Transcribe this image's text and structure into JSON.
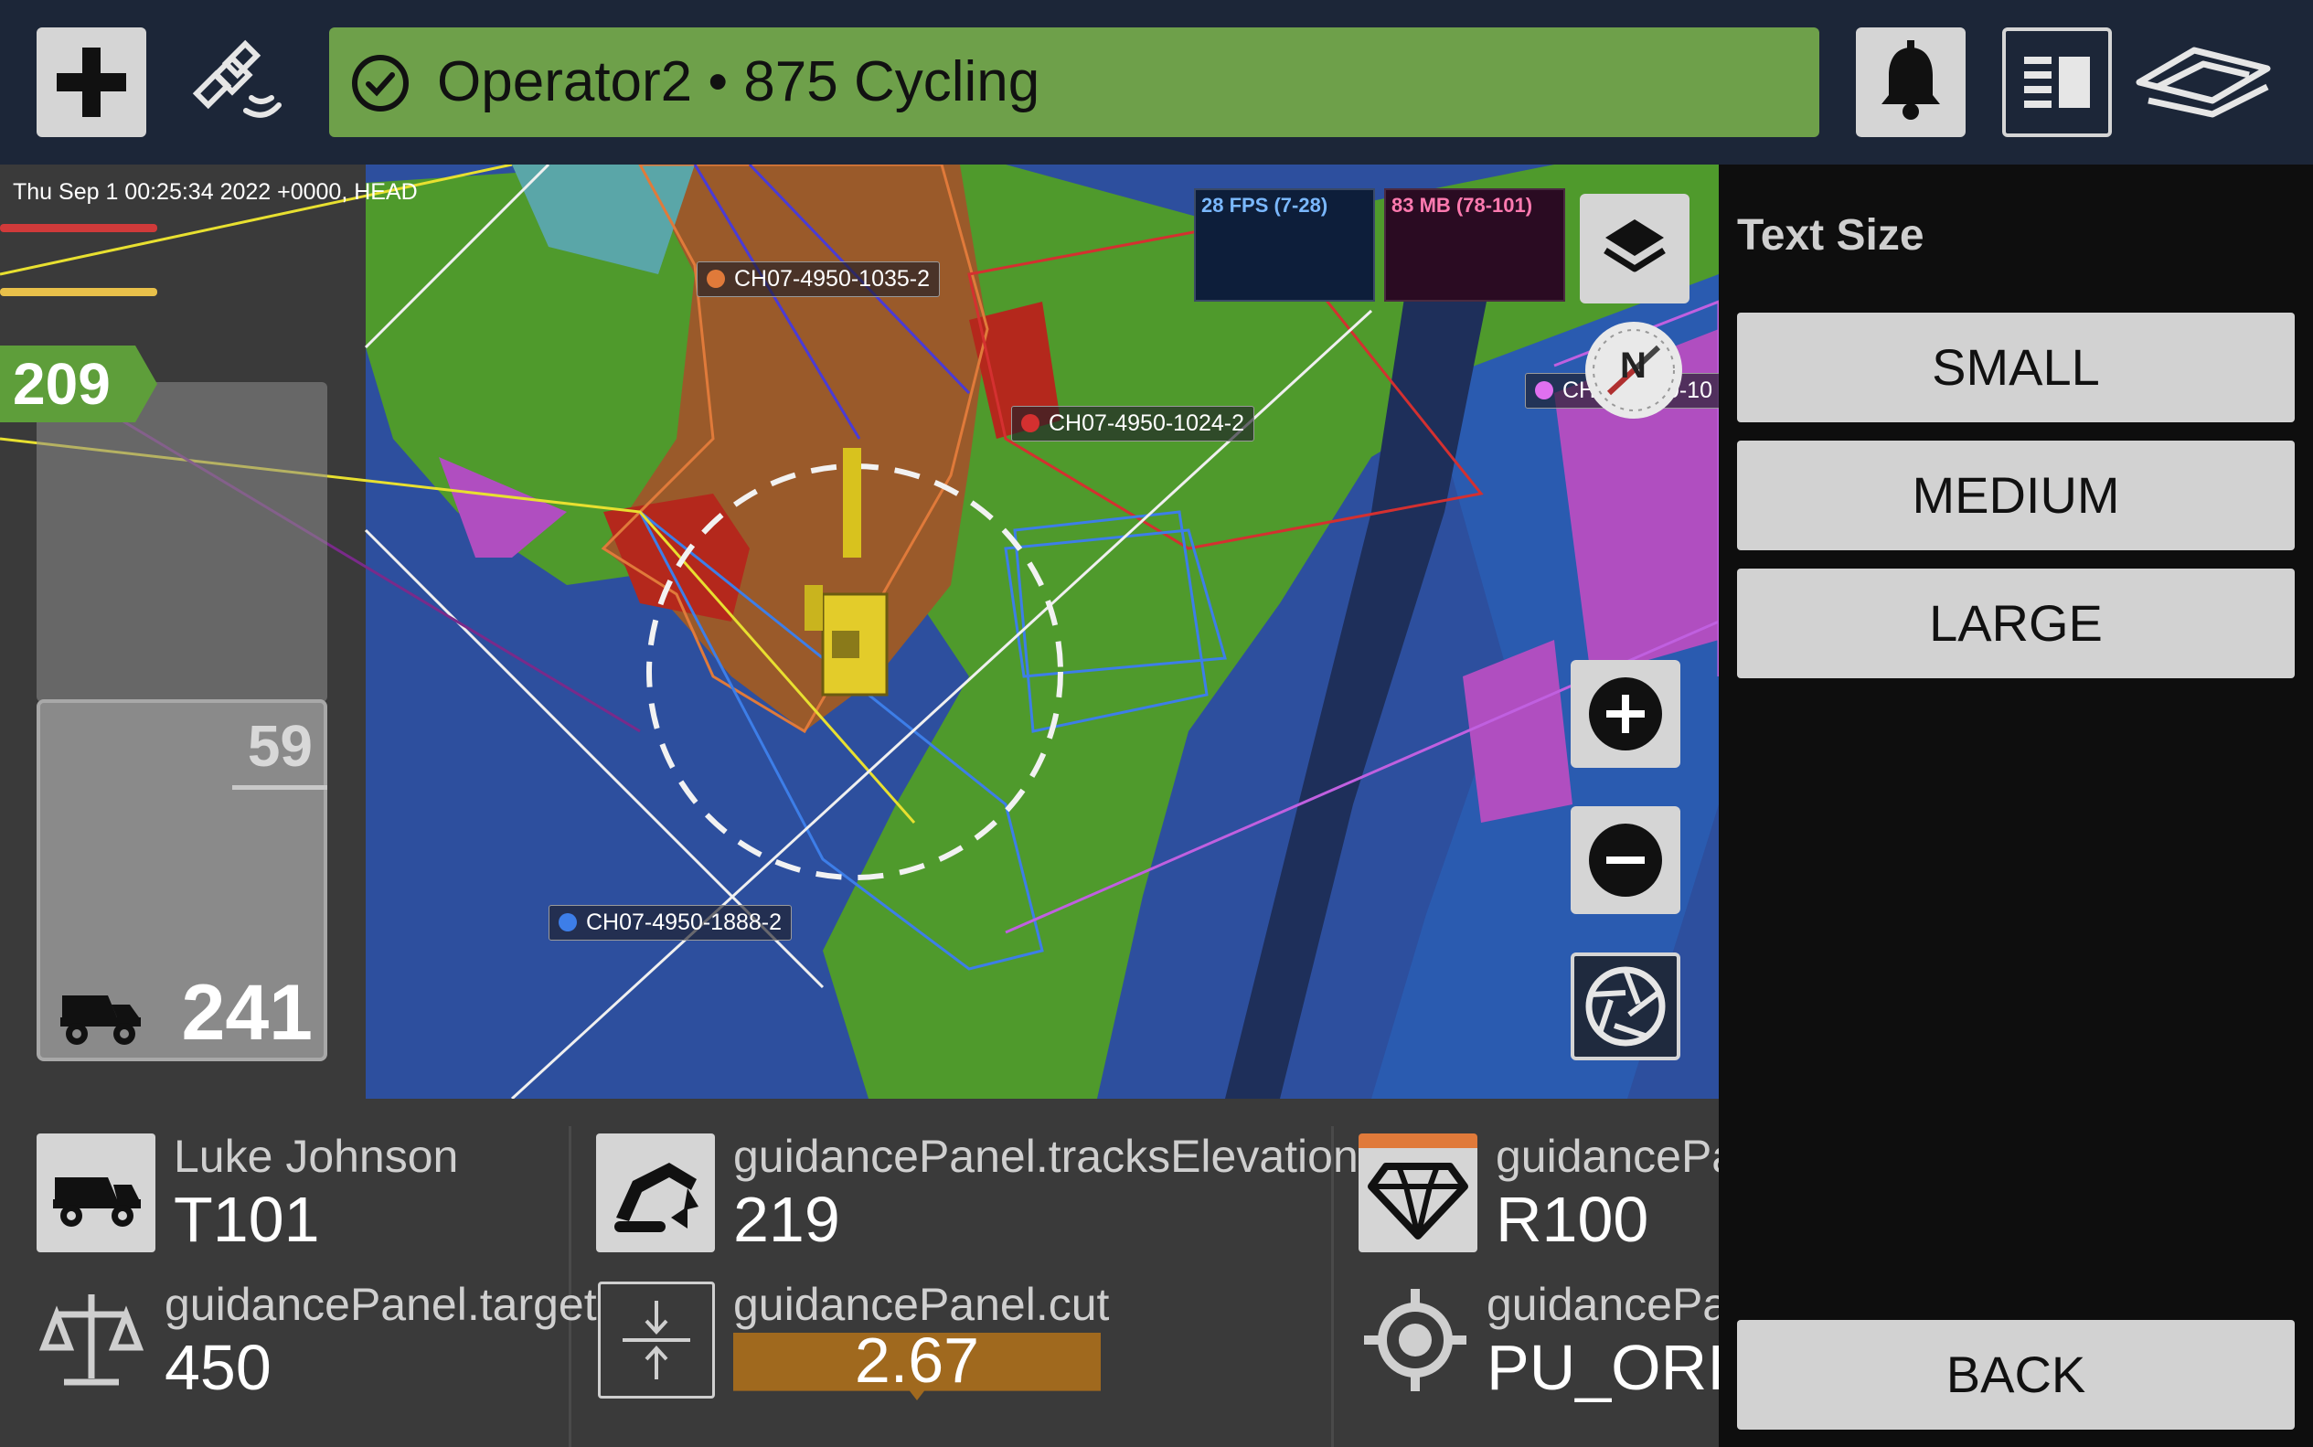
{
  "header": {
    "status_text": "Operator2 • 875 Cycling",
    "status_color": "#6ea04a",
    "icons": [
      "plus-icon",
      "satellite-icon",
      "check-circle-icon",
      "bell-icon",
      "layout-panel-icon",
      "brand-logo-icon"
    ]
  },
  "map": {
    "timestamp": "Thu Sep 1 00:25:34 2022 +0000, HEAD",
    "badge_value": "209",
    "panel_top_value": "59",
    "panel_bottom_value": "241",
    "fps_label": "28 FPS (7-28)",
    "mb_label": "83 MB (78-101)",
    "compass_letter": "N",
    "labels": {
      "block1": "CH07-4950-1035-2",
      "block2": "CH07-4950-1024-2",
      "block3": "CH07-4950-1888-2",
      "block4": "CH07-4950-10"
    }
  },
  "right_panel": {
    "title": "Text Size",
    "options": [
      "SMALL",
      "MEDIUM",
      "LARGE"
    ],
    "back_label": "BACK"
  },
  "guidance": {
    "truck": {
      "label": "Luke Johnson",
      "value": "T101"
    },
    "tracks": {
      "label": "guidancePanel.tracksElevation",
      "value": "219"
    },
    "material": {
      "label": "guidancePa",
      "value": "R100"
    },
    "target": {
      "label": "guidancePanel.target",
      "value": "450"
    },
    "cut": {
      "label": "guidancePanel.cut",
      "value": "2.67",
      "color": "#a0691e"
    },
    "origin": {
      "label": "guidancePa",
      "value": "PU_ORI"
    }
  }
}
